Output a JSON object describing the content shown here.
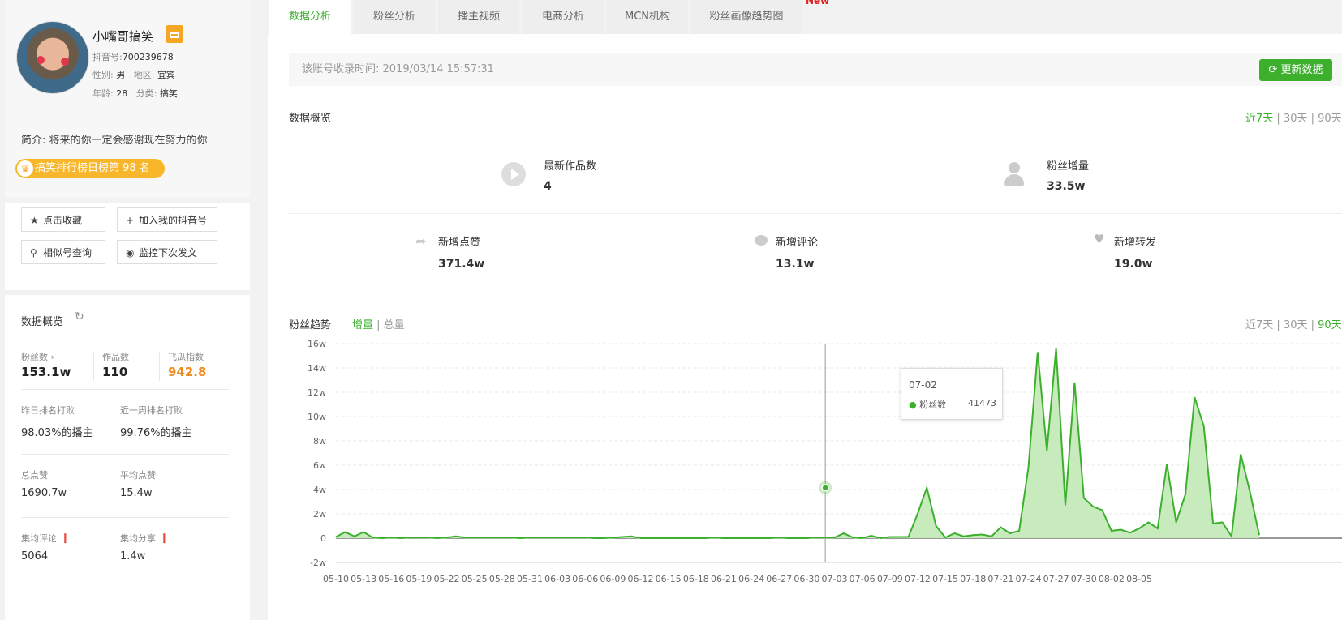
{
  "profile": {
    "name": "小嘴哥搞笑",
    "douyin_id_label": "抖音号:",
    "douyin_id": "700239678",
    "gender_label": "性别:",
    "gender": "男",
    "region_label": "地区:",
    "region": "宜宾",
    "age_label": "年龄:",
    "age": "28",
    "category_label": "分类:",
    "category": "搞笑",
    "intro": "简介: 将来的你一定会感谢现在努力的你",
    "rank_text": "搞笑排行榜日榜第 98 名"
  },
  "actions": {
    "favorite": "点击收藏",
    "add_mine": "加入我的抖音号",
    "similar": "相似号查询",
    "monitor": "监控下次发文"
  },
  "overview": {
    "title": "数据概览",
    "fans_label": "粉丝数",
    "fans_value": "153.1w",
    "works_label": "作品数",
    "works_value": "110",
    "feigua_label": "飞瓜指数",
    "feigua_value": "942.8",
    "yesterday_rank_label": "昨日排名打败",
    "yesterday_rank_value": "98.03%的播主",
    "week_rank_label": "近一周排名打败",
    "week_rank_value": "99.76%的播主",
    "total_likes_label": "总点赞",
    "total_likes_value": "1690.7w",
    "avg_likes_label": "平均点赞",
    "avg_likes_value": "15.4w",
    "avg_comments_label": "集均评论",
    "avg_comments_value": "5064",
    "avg_shares_label": "集均分享",
    "avg_shares_value": "1.4w"
  },
  "tabs": [
    "数据分析",
    "粉丝分析",
    "播主视频",
    "电商分析",
    "MCN机构",
    "粉丝画像趋势图"
  ],
  "new_tag": "New",
  "info": {
    "record_text": "该账号收录时间: 2019/03/14 15:57:31",
    "update_button": "更新数据"
  },
  "data_overview": {
    "title": "数据概览",
    "range": [
      "近7天",
      "30天",
      "90天"
    ],
    "range_selected": "近7天",
    "new_works_label": "最新作品数",
    "new_works_value": "4",
    "fans_growth_label": "粉丝增量",
    "fans_growth_value": "33.5w",
    "likes_label": "新增点赞",
    "likes_value": "371.4w",
    "comments_label": "新增评论",
    "comments_value": "13.1w",
    "shares_label": "新增转发",
    "shares_value": "19.0w"
  },
  "trend": {
    "title": "粉丝趋势",
    "mode_increment": "增量",
    "mode_total": "总量",
    "range": [
      "近7天",
      "30天",
      "90天"
    ],
    "range_selected": "90天",
    "tooltip_date": "07-02",
    "tooltip_series": "粉丝数",
    "tooltip_value": "41473"
  },
  "colors": {
    "accent": "#3cb02d",
    "area_fill": "#c8ebbd",
    "orange": "#f08c1e",
    "rank_pill": "#f8b62b"
  },
  "chart_data": {
    "type": "area",
    "series": [
      {
        "name": "粉丝数"
      }
    ],
    "ylim": [
      -2,
      16
    ],
    "y_ticks": [
      "-2w",
      "0",
      "2w",
      "4w",
      "6w",
      "8w",
      "10w",
      "12w",
      "14w",
      "16w"
    ],
    "y_unit": "w (10k)",
    "x_tick_labels": [
      "05-10",
      "05-13",
      "05-16",
      "05-19",
      "05-22",
      "05-25",
      "05-28",
      "05-31",
      "06-03",
      "06-06",
      "06-09",
      "06-12",
      "06-15",
      "06-18",
      "06-21",
      "06-24",
      "06-27",
      "06-30",
      "07-03",
      "07-06",
      "07-09",
      "07-12",
      "07-15",
      "07-18",
      "07-21",
      "07-24",
      "07-27",
      "07-30",
      "08-02",
      "08-05"
    ],
    "start_date": "05-10",
    "values_w": [
      0.1,
      0.5,
      0.15,
      0.5,
      0.05,
      0.0,
      0.05,
      0.0,
      0.05,
      0.05,
      0.05,
      0.0,
      0.05,
      0.15,
      0.05,
      0.05,
      0.05,
      0.05,
      0.05,
      0.05,
      0.0,
      0.05,
      0.05,
      0.05,
      0.05,
      0.05,
      0.05,
      0.05,
      0.0,
      0.0,
      0.05,
      0.1,
      0.15,
      0.0,
      0.0,
      0.0,
      0.0,
      0.0,
      0.0,
      0.0,
      0.0,
      0.05,
      0.0,
      0.0,
      0.0,
      0.0,
      0.0,
      0.0,
      0.05,
      0.0,
      0.0,
      0.0,
      0.05,
      0.05,
      0.05,
      0.4,
      0.05,
      0.0,
      0.2,
      0.0,
      0.1,
      0.1,
      0.1,
      2.0,
      4.1473,
      1.0,
      0.05,
      0.4,
      0.15,
      0.25,
      0.3,
      0.15,
      0.9,
      0.4,
      0.6,
      5.8,
      15.3,
      7.2,
      15.6,
      2.7,
      12.8,
      3.3,
      2.6,
      2.3,
      0.6,
      0.7,
      0.45,
      0.8,
      1.3,
      0.8,
      6.1,
      1.3,
      3.6,
      11.6,
      9.2,
      1.2,
      1.3,
      0.15,
      6.9,
      3.8,
      0.25
    ],
    "highlight": {
      "date": "07-02",
      "value": 41473
    }
  }
}
